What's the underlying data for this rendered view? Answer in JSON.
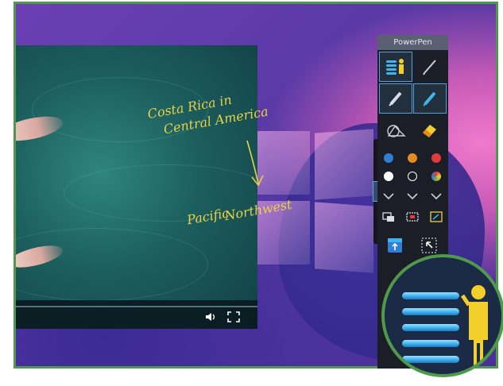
{
  "toolbar": {
    "title": "PowerPen"
  },
  "annotations": {
    "line1": "Costa Rica in",
    "line2": "Central America",
    "line3": "Pacific",
    "line4": "Northwest"
  },
  "video": {
    "icons": [
      "volume-icon",
      "fullscreen-icon"
    ]
  },
  "side_strip": {
    "icons": [
      "arrow-right-icon",
      "windows-icon",
      "whiteboard-icon",
      "presenter-icon",
      "close-icon"
    ]
  },
  "colors": {
    "ink": "#e8d246",
    "frame": "#4f9a4a",
    "palette": [
      "#2f7fd6",
      "#e68a1f",
      "#e23a3a",
      "#ffffff",
      "#1b1e26",
      "#8aa84a"
    ]
  }
}
